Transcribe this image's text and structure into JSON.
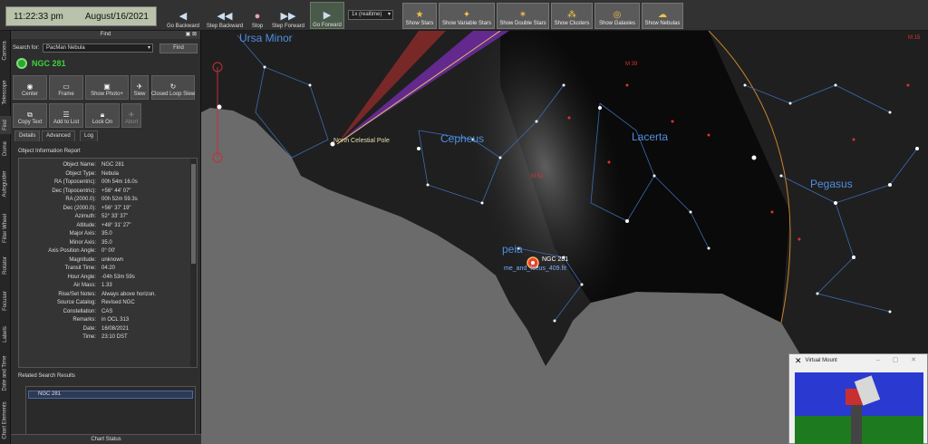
{
  "clock": {
    "time": "11:22:33 pm",
    "date": "August/16/2021"
  },
  "toolbar": {
    "go_backward": "Go Backward",
    "step_backward": "Step Backward",
    "stop": "Stop",
    "step_forward": "Step Forward",
    "go_forward": "Go Forward",
    "speed": "1x (realtime)",
    "show_stars": "Show Stars",
    "show_variable_stars": "Show Variable Stars",
    "show_double_stars": "Show Double Stars",
    "show_clusters": "Show Clusters",
    "show_galaxies": "Show Galaxies",
    "show_nebulas": "Show Nebulas"
  },
  "vtabs": [
    "Camera",
    "Telescope",
    "Find",
    "Dome",
    "Autoguider",
    "Filter Wheel",
    "Rotator",
    "Focuser",
    "Labels",
    "Date and Time",
    "Chart Elements"
  ],
  "find": {
    "title": "Find",
    "search_label": "Search for:",
    "search_value": "PacMan Nebula",
    "find_button": "Find",
    "object": "NGC 281",
    "actions": [
      "Center",
      "Frame",
      "Show Photo+",
      "Slew",
      "Closed Loop Slew",
      "Copy Text",
      "Add to List",
      "Lock On",
      "Abort"
    ],
    "tabs": [
      "Details",
      "Advanced",
      "Log"
    ],
    "info_header": "Object Information Report",
    "info": [
      {
        "k": "Object Name:",
        "v": "NGC 281"
      },
      {
        "k": "Object Type:",
        "v": "Nebula"
      },
      {
        "k": "RA (Topocentric):",
        "v": "00h 54m 16.0s"
      },
      {
        "k": "Dec (Topocentric):",
        "v": "+56° 44' 07\""
      },
      {
        "k": "RA (2000.0):",
        "v": "00h 52m 59.3s"
      },
      {
        "k": "Dec (2000.0):",
        "v": "+56° 37' 19\""
      },
      {
        "k": "Azimuth:",
        "v": "52° 33' 37\""
      },
      {
        "k": "Altitude:",
        "v": "+48° 31' 27\""
      },
      {
        "k": "Major Axis:",
        "v": "35.0"
      },
      {
        "k": "Minor Axis:",
        "v": "35.0"
      },
      {
        "k": "Axis Position Angle:",
        "v": "0° 00'"
      },
      {
        "k": "Magnitude:",
        "v": "unknown"
      },
      {
        "k": "Transit Time:",
        "v": "04:20"
      },
      {
        "k": "Hour Angle:",
        "v": "-04h 53m 59s"
      },
      {
        "k": "Air Mass:",
        "v": "1.33"
      },
      {
        "k": "Rise/Set Notes:",
        "v": "Always above horizon."
      },
      {
        "k": "Source Catalog:",
        "v": "Revised NGC"
      },
      {
        "k": "Constellation:",
        "v": "CAS"
      },
      {
        "k": "Remarks:",
        "v": "in OCL 313"
      },
      {
        "k": "Date:",
        "v": "16/08/2021"
      },
      {
        "k": "Time:",
        "v": "23:10 DST"
      }
    ],
    "related_header": "Related Search Results",
    "related": [
      "NGC 281"
    ],
    "chart_status": "Chart Status"
  },
  "sky": {
    "constellations": [
      "Ursa Minor",
      "Cepheus",
      "Lacerta",
      "Pegasus",
      "peia"
    ],
    "ncp_label": "North Celestial Pole",
    "target_label": "NGC 281",
    "target_sublabel": "me_and_focus_409.fit",
    "messier": [
      "M 15",
      "M 39",
      "M 52"
    ],
    "colors": {
      "constellation_text": "#4f8fe0",
      "horizon": "#6b6b6b",
      "target": "#e8442e"
    }
  },
  "vmount": {
    "title": "Virtual Mount"
  }
}
